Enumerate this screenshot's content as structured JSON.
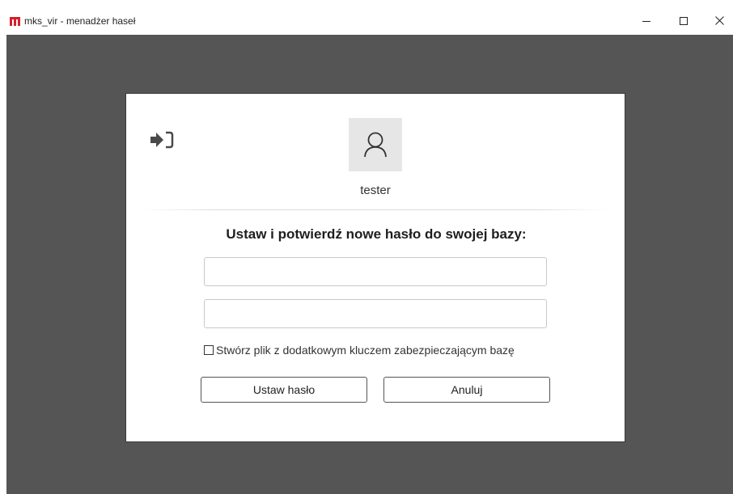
{
  "window": {
    "title": "mks_vir - menadżer haseł",
    "icon": "mks-logo-icon",
    "controls": [
      "minimize-icon",
      "maximize-icon",
      "close-icon"
    ],
    "brand_color": "#d4202a",
    "background_color": "#555555"
  },
  "dialog": {
    "login_icon": "sign-in-icon",
    "avatar_icon": "user-icon",
    "username": "tester",
    "heading": "Ustaw i potwierdź nowe hasło do swojej bazy:",
    "password_field": {
      "value": "",
      "placeholder": ""
    },
    "confirm_field": {
      "value": "",
      "placeholder": ""
    },
    "keyfile_checkbox": {
      "label": "Stwórz plik z dodatkowym kluczem zabezpieczającym bazę",
      "checked": false
    },
    "set_button_label": "Ustaw hasło",
    "cancel_button_label": "Anuluj"
  }
}
